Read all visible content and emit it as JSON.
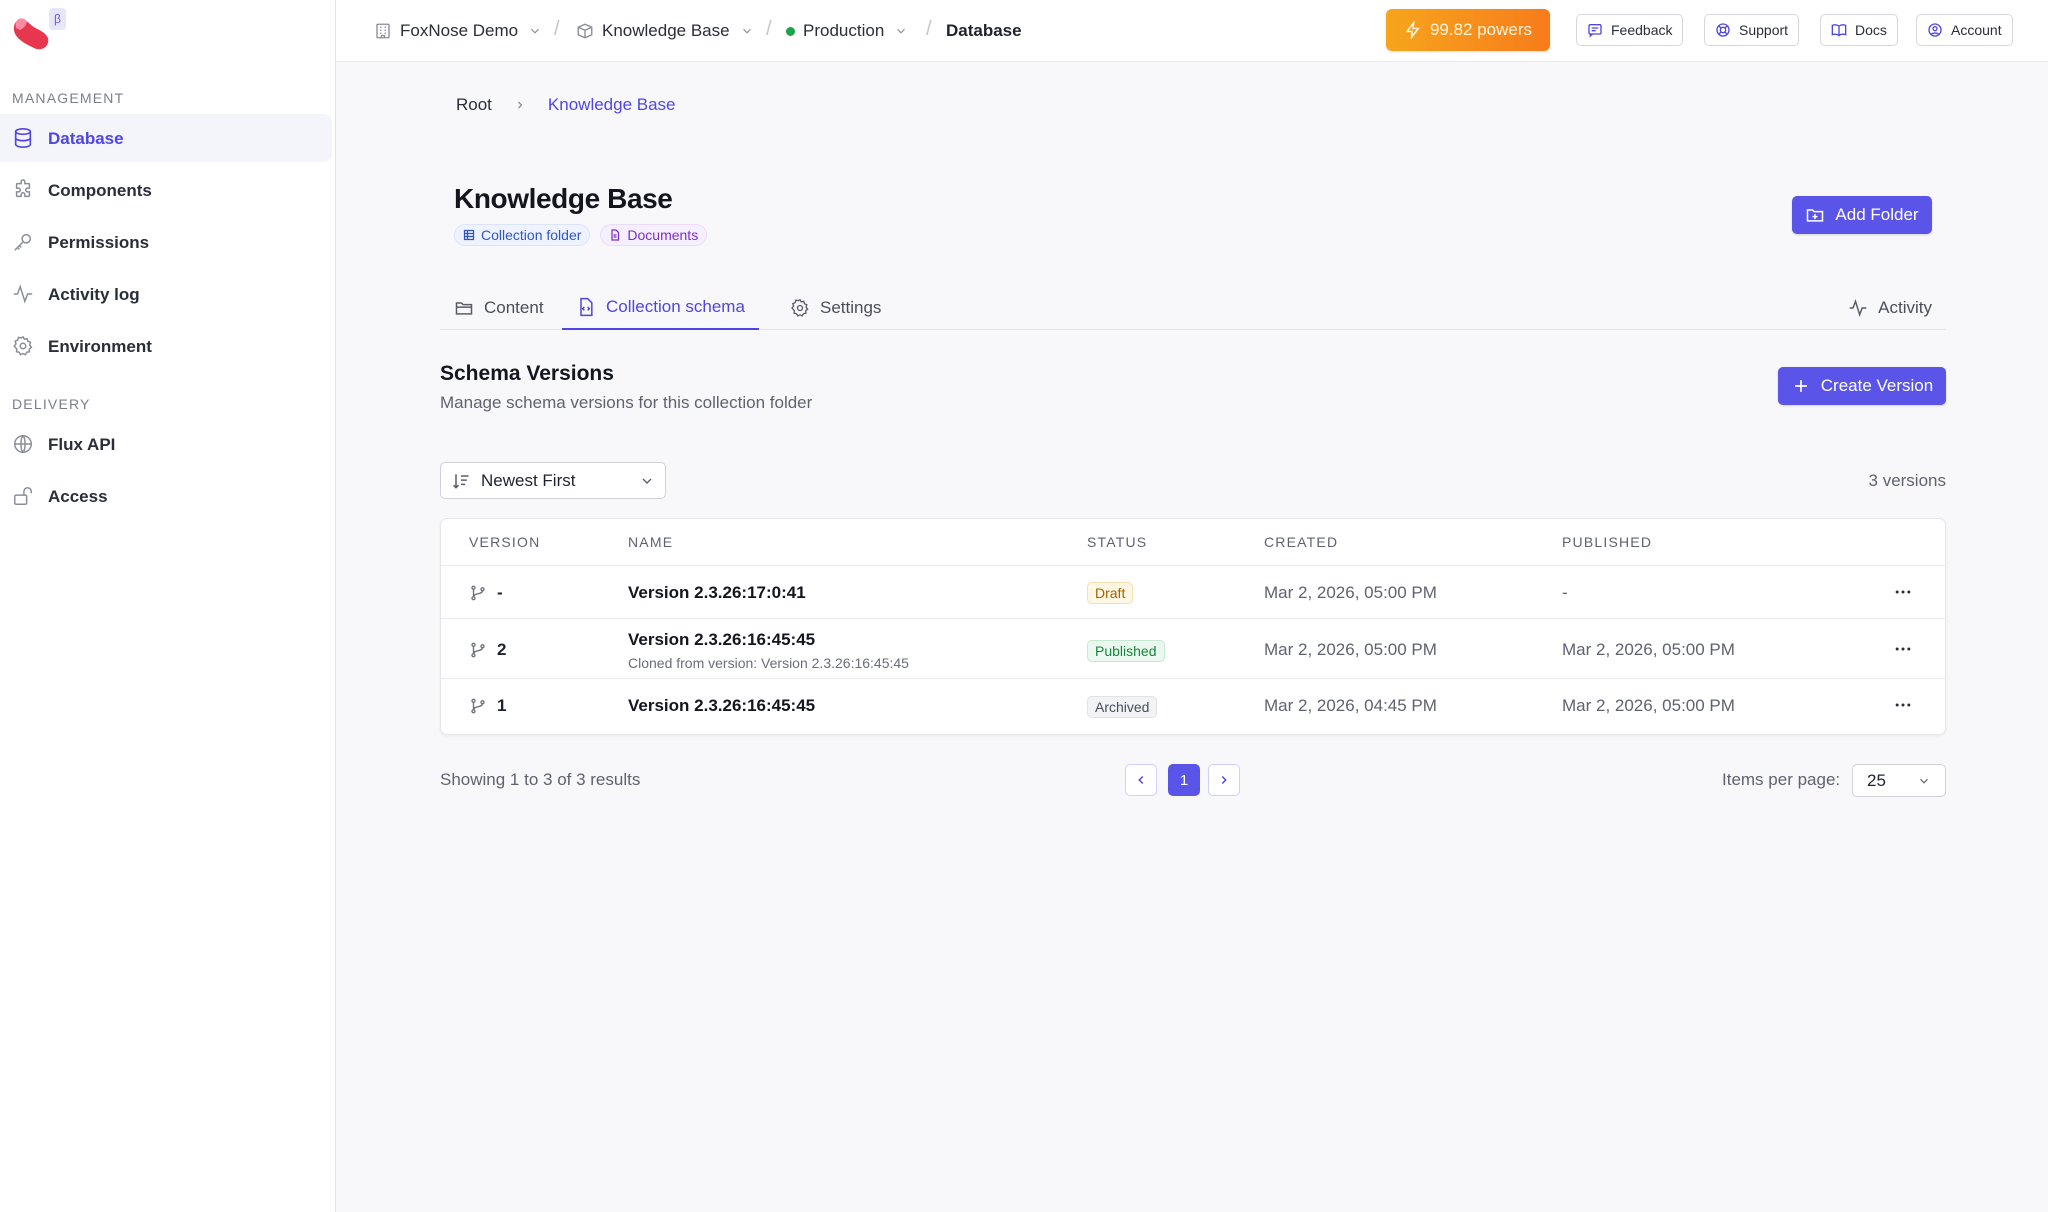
{
  "brand": {
    "beta_badge": "β",
    "logo_colors": [
      "#e6374f",
      "#ff8aa0"
    ]
  },
  "sidebar": {
    "sections": [
      {
        "label": "MANAGEMENT"
      },
      {
        "label": "DELIVERY"
      }
    ],
    "items": [
      {
        "label": "Database",
        "icon": "database-icon",
        "active": true
      },
      {
        "label": "Components",
        "icon": "puzzle-icon"
      },
      {
        "label": "Permissions",
        "icon": "key-icon"
      },
      {
        "label": "Activity log",
        "icon": "activity-icon"
      },
      {
        "label": "Environment",
        "icon": "gear-icon"
      },
      {
        "label": "Flux API",
        "icon": "globe-icon"
      },
      {
        "label": "Access",
        "icon": "lock-open-icon"
      }
    ]
  },
  "topbar": {
    "crumbs": [
      {
        "label": "FoxNose Demo",
        "icon": "building-icon"
      },
      {
        "label": "Knowledge Base",
        "icon": "box-icon"
      },
      {
        "label": "Production",
        "icon": "status-dot"
      },
      {
        "label": "Database"
      }
    ],
    "separator": "/",
    "powers": "99.82 powers",
    "buttons": [
      {
        "label": "Feedback",
        "icon": "message-icon"
      },
      {
        "label": "Support",
        "icon": "lifebuoy-icon"
      },
      {
        "label": "Docs",
        "icon": "book-icon"
      },
      {
        "label": "Account",
        "icon": "user-circle-icon"
      }
    ]
  },
  "breadcrumb": {
    "root": "Root",
    "current": "Knowledge Base"
  },
  "page": {
    "title": "Knowledge Base",
    "tags": [
      "Collection folder",
      "Documents"
    ],
    "add_folder": "Add Folder"
  },
  "tabs": [
    {
      "label": "Content",
      "icon": "folder-open-icon"
    },
    {
      "label": "Collection schema",
      "icon": "file-code-icon",
      "active": true
    },
    {
      "label": "Settings",
      "icon": "gear-icon"
    }
  ],
  "activity_tab": "Activity",
  "schema": {
    "title": "Schema Versions",
    "subtitle": "Manage schema versions for this collection folder",
    "create_button": "Create Version",
    "sort": "Newest First",
    "count": "3 versions"
  },
  "table": {
    "headers": [
      "VERSION",
      "NAME",
      "STATUS",
      "CREATED",
      "PUBLISHED"
    ],
    "rows": [
      {
        "version": "-",
        "name": "Version 2.3.26:17:0:41",
        "sub": "",
        "status": "Draft",
        "created": "Mar 2, 2026, 05:00 PM",
        "published": "-"
      },
      {
        "version": "2",
        "name": "Version 2.3.26:16:45:45",
        "sub": "Cloned from version: Version 2.3.26:16:45:45",
        "status": "Published",
        "created": "Mar 2, 2026, 05:00 PM",
        "published": "Mar 2, 2026, 05:00 PM"
      },
      {
        "version": "1",
        "name": "Version 2.3.26:16:45:45",
        "sub": "",
        "status": "Archived",
        "created": "Mar 2, 2026, 04:45 PM",
        "published": "Mar 2, 2026, 05:00 PM"
      }
    ]
  },
  "pagination": {
    "showing": "Showing 1 to 3 of 3 results",
    "current_page": "1",
    "items_per_page_label": "Items per page:",
    "items_per_page": "25"
  },
  "colors": {
    "accent": "#4f46e5",
    "primary_button": "#5b54e8",
    "powers_gradient_start": "#f7a51c",
    "powers_gradient_end": "#f77c1b"
  }
}
